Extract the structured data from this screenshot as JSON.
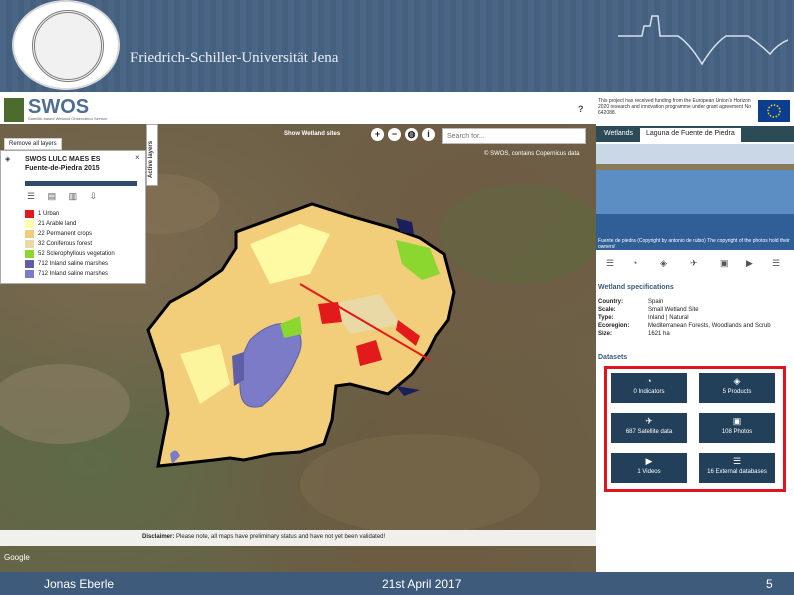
{
  "slide": {
    "university": "Friedrich-Schiller-Universität Jena",
    "footer_author": "Jonas Eberle",
    "footer_date": "21st April 2017",
    "page_number": "5"
  },
  "app": {
    "logo_text": "SWOS",
    "logo_subtitle": "Satellite-based Wetland Observation Service",
    "help_label": "?"
  },
  "map": {
    "remove_layers_label": "Remove all layers",
    "show_wetland_label": "Show Wetland sites",
    "search_placeholder": "Search for...",
    "copyright": "© SWOS, contains Copernicus data",
    "google_mark": "Google",
    "disclaimer_label": "Disclaimer:",
    "disclaimer_text": "Please note, all maps have preliminary status and have not yet been validated!",
    "active_layers_label": "Active layers",
    "zoom_in": "+",
    "zoom_out": "−",
    "info": "i"
  },
  "legend": {
    "title_line1": "SWOS LULC MAES ES",
    "title_line2": "Fuente-de-Piedra 2015",
    "items": [
      {
        "label": "1 Urban",
        "color": "#e31a1c"
      },
      {
        "label": "21 Arable land",
        "color": "#ffffa8"
      },
      {
        "label": "22 Permanent crops",
        "color": "#f2cd7a"
      },
      {
        "label": "32 Coniferous forest",
        "color": "#e8d9a6"
      },
      {
        "label": "52 Sclerophyllous vegetation",
        "color": "#8bd72f"
      },
      {
        "label": "712 Inland saline marshes",
        "color": "#5f5fa8"
      },
      {
        "label": "712 Inland saline marshes",
        "color": "#7b7bc8"
      }
    ]
  },
  "right_panel": {
    "eu_text": "This project has received funding from the European Union's Horizon 2020 research and innovation programme under grant agreement No 642088.",
    "tab_wetlands": "Wetlands",
    "tab_site": "Laguna de Fuente de Piedra",
    "photo_caption": "Fuente de piedra (Copyright by antonio de rubio) The copyright of the photos hold their owners!",
    "spec_title": "Wetland specifications",
    "specs": [
      {
        "key": "Country:",
        "value": "Spain"
      },
      {
        "key": "Scale:",
        "value": "Small Wetland Site"
      },
      {
        "key": "Type:",
        "value": "Inland | Natural"
      },
      {
        "key": "Ecoregion:",
        "value": "Mediterranean Forests, Woodlands and Scrub"
      },
      {
        "key": "Size:",
        "value": "1621 ha"
      }
    ],
    "datasets_title": "Datasets",
    "datasets": [
      {
        "label": "0 Indicators",
        "icon": "◔"
      },
      {
        "label": "5 Products",
        "icon": "◈"
      },
      {
        "label": "687 Satellite data",
        "icon": "✈"
      },
      {
        "label": "108 Photos",
        "icon": "▣"
      },
      {
        "label": "1 Videos",
        "icon": "▶"
      },
      {
        "label": "16 External databases",
        "icon": "☰"
      }
    ]
  }
}
